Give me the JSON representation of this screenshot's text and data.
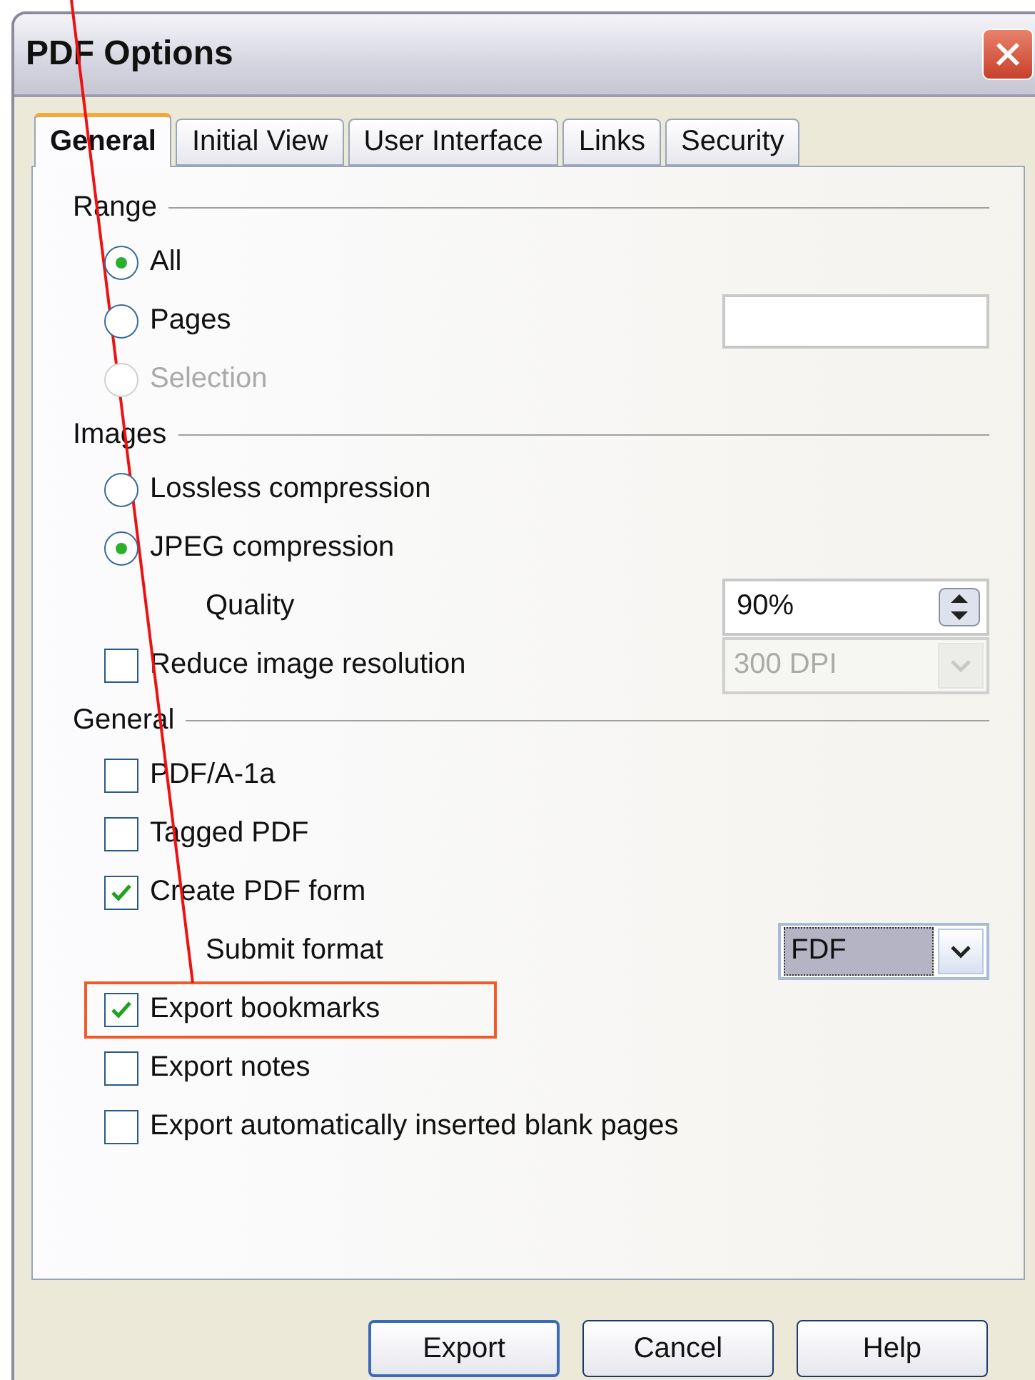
{
  "window": {
    "title": "PDF Options"
  },
  "tabs": [
    {
      "label": "General",
      "selected": true
    },
    {
      "label": "Initial View",
      "selected": false
    },
    {
      "label": "User Interface",
      "selected": false
    },
    {
      "label": "Links",
      "selected": false
    },
    {
      "label": "Security",
      "selected": false
    }
  ],
  "sections": [
    {
      "title": "Range",
      "items": [
        {
          "kind": "radio",
          "label": "All",
          "selected": true,
          "disabled": false
        },
        {
          "kind": "radio",
          "label": "Pages",
          "selected": false,
          "disabled": false,
          "control": {
            "kind": "text_field"
          }
        },
        {
          "kind": "radio",
          "label": "Selection",
          "selected": false,
          "disabled": true
        }
      ]
    },
    {
      "title": "Images",
      "items": [
        {
          "kind": "radio",
          "label": "Lossless compression",
          "selected": false,
          "disabled": false
        },
        {
          "kind": "radio",
          "label": "JPEG compression",
          "selected": true,
          "disabled": false
        },
        {
          "kind": "label",
          "label": "Quality",
          "control": {
            "kind": "spinbox",
            "value": "90%"
          }
        },
        {
          "kind": "checkbox",
          "label": "Reduce image resolution",
          "checked": false,
          "control": {
            "kind": "dropdown",
            "value": "300 DPI",
            "disabled": true
          }
        }
      ]
    },
    {
      "title": "General",
      "items": [
        {
          "kind": "checkbox",
          "label": "PDF/A-1a",
          "checked": false
        },
        {
          "kind": "checkbox",
          "label": "Tagged PDF",
          "checked": false
        },
        {
          "kind": "checkbox",
          "label": "Create PDF form",
          "checked": true
        },
        {
          "kind": "label",
          "label": "Submit format",
          "control": {
            "kind": "dropdown",
            "value": "FDF",
            "disabled": false
          }
        },
        {
          "kind": "checkbox",
          "label": "Export bookmarks",
          "checked": true,
          "highlighted": true
        },
        {
          "kind": "checkbox",
          "label": "Export notes",
          "checked": false
        },
        {
          "kind": "checkbox",
          "label": "Export automatically inserted blank pages",
          "checked": false
        }
      ]
    }
  ],
  "buttons": [
    {
      "label": "Export"
    },
    {
      "label": "Cancel"
    },
    {
      "label": "Help"
    }
  ]
}
